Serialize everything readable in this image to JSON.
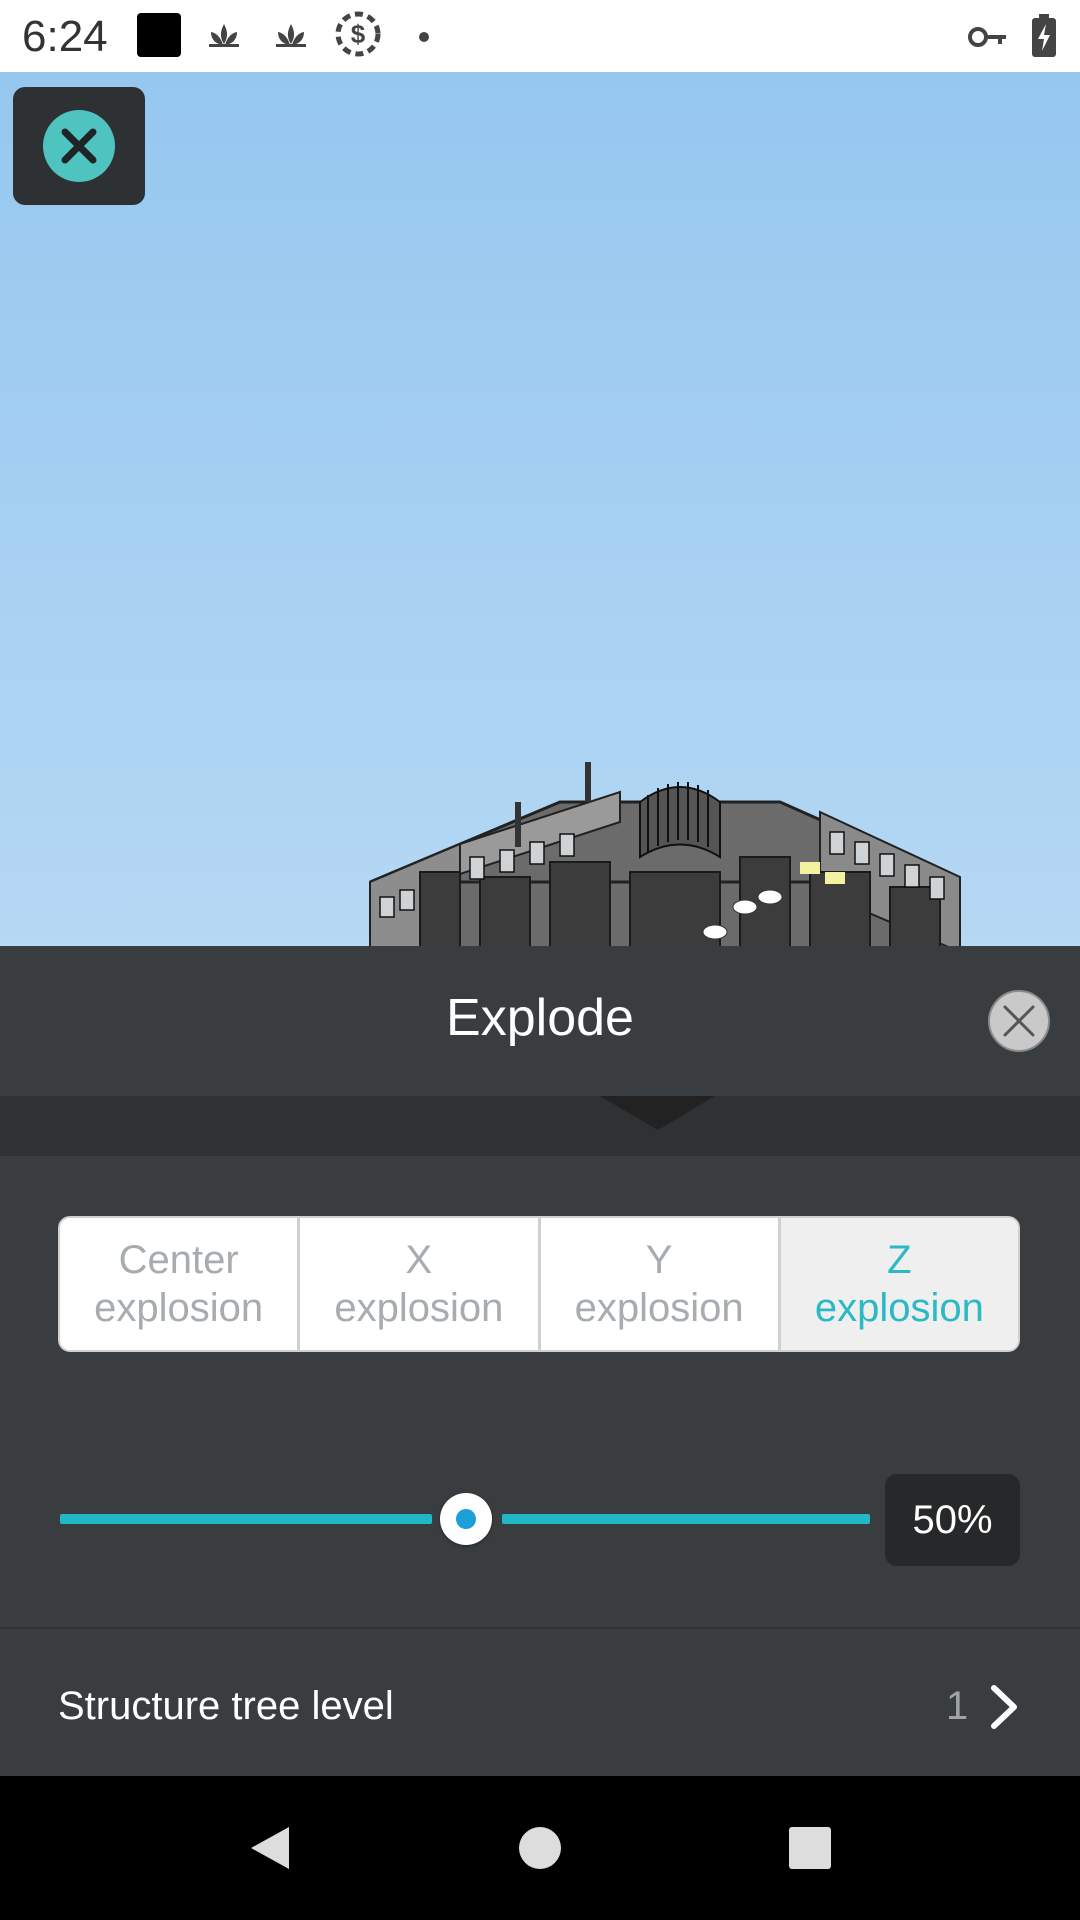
{
  "status_bar": {
    "time": "6:24"
  },
  "viewer": {
    "close_icon": "close-x-icon"
  },
  "panel": {
    "title": "Explode",
    "tabs": [
      {
        "label": "Center\nexplosion",
        "active": false
      },
      {
        "label": "X\nexplosion",
        "active": false
      },
      {
        "label": "Y\nexplosion",
        "active": false
      },
      {
        "label": "Z\nexplosion",
        "active": true
      }
    ],
    "slider": {
      "value_percent": 50,
      "value_label": "50%"
    },
    "structure_tree": {
      "label": "Structure tree level",
      "value": "1"
    }
  },
  "colors": {
    "accent": "#2bb9c6",
    "panel_bg": "#3a3d3f",
    "sky_top": "#96c7ef",
    "sky_bottom": "#b5d8f4"
  }
}
